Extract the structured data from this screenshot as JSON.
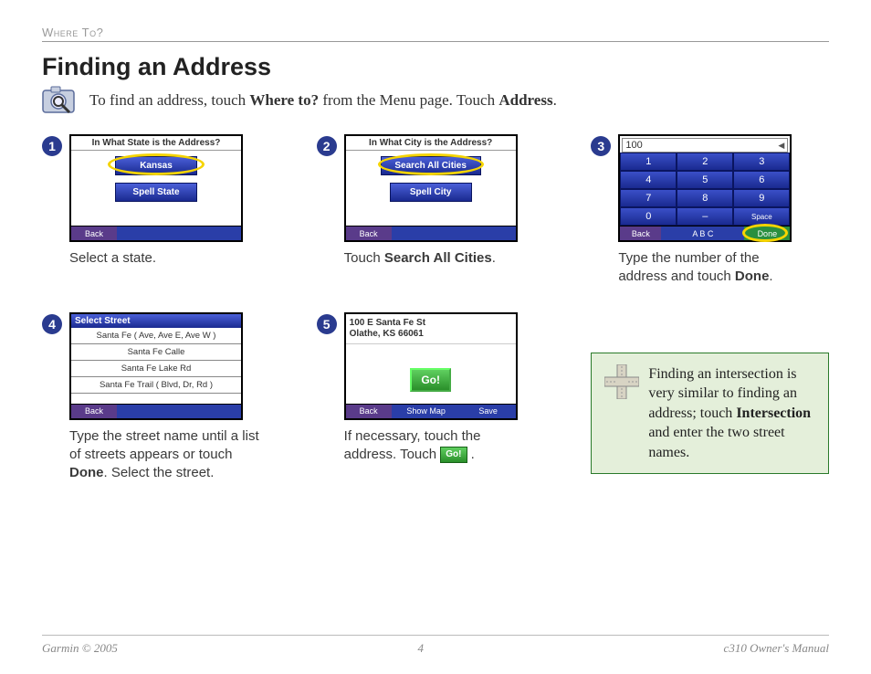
{
  "breadcrumb": "Where To?",
  "title": "Finding an Address",
  "intro": {
    "lead": "To find an address, touch ",
    "bold1": "Where to?",
    "mid": " from the Menu page. Touch ",
    "bold2": "Address",
    "tail": "."
  },
  "steps": {
    "s1": {
      "num": "1",
      "screen_title": "In What State is the Address?",
      "btn1": "Kansas",
      "btn2": "Spell State",
      "back": "Back",
      "caption": "Select a state."
    },
    "s2": {
      "num": "2",
      "screen_title": "In What City is the Address?",
      "btn1": "Search All Cities",
      "btn2": "Spell City",
      "back": "Back",
      "caption_a": "Touch ",
      "caption_b": "Search All Cities",
      "caption_c": "."
    },
    "s3": {
      "num": "3",
      "input_value": "100",
      "keys": [
        "1",
        "2",
        "3",
        "4",
        "5",
        "6",
        "7",
        "8",
        "9",
        "0",
        "–",
        "Space"
      ],
      "back": "Back",
      "abc": "A B C",
      "done": "Done",
      "caption_a": "Type the number of the address and touch ",
      "caption_b": "Done",
      "caption_c": "."
    },
    "s4": {
      "num": "4",
      "list_title": "Select Street",
      "rows": [
        "Santa Fe ( Ave, Ave E, Ave W )",
        "Santa Fe Calle",
        "Santa Fe Lake Rd",
        "Santa Fe Trail ( Blvd, Dr, Rd )"
      ],
      "back": "Back",
      "caption_a": "Type the street name until a list of streets appears or touch ",
      "caption_b": "Done",
      "caption_c": ". Select the street."
    },
    "s5": {
      "num": "5",
      "addr_line1": "100 E Santa Fe St",
      "addr_line2": "Olathe, KS 66061",
      "go": "Go!",
      "back": "Back",
      "showmap": "Show Map",
      "save": "Save",
      "caption_a": "If necessary, touch the address. Touch ",
      "go_inline": "Go!",
      "caption_b": "."
    }
  },
  "tip": {
    "text_a": "Finding an intersection is very similar to finding an address; touch ",
    "bold": "Intersection",
    "text_b": " and enter the two street names."
  },
  "footer": {
    "left": "Garmin © 2005",
    "center": "4",
    "right": "c310 Owner's Manual"
  }
}
